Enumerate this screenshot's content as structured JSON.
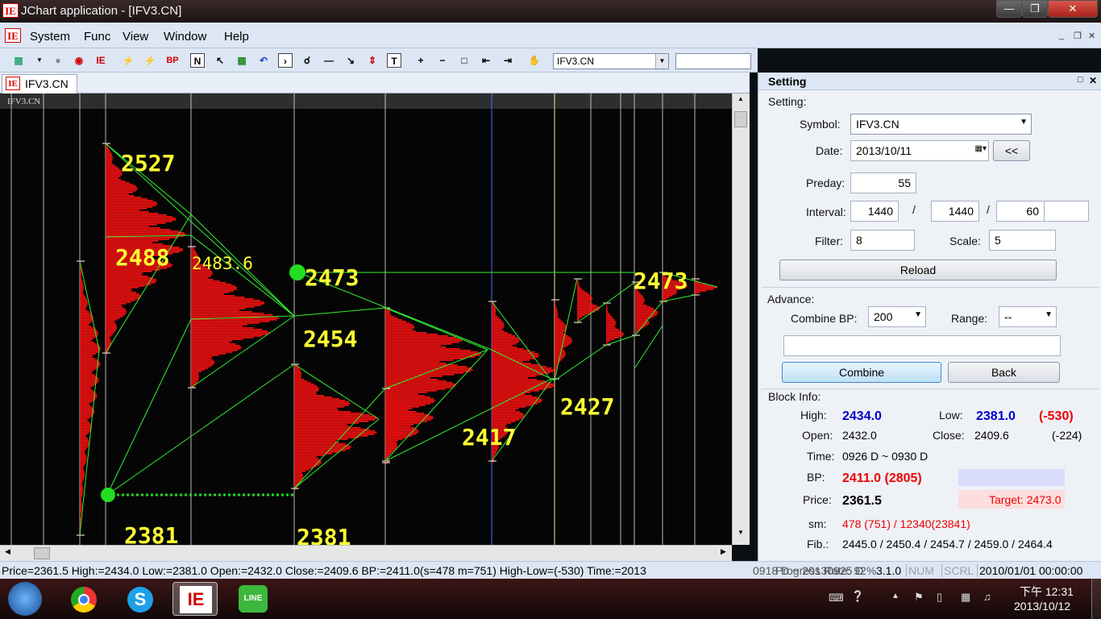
{
  "window": {
    "title": "JChart application - [IFV3.CN]"
  },
  "menu": {
    "items": [
      "System",
      "Func",
      "View",
      "Window",
      "Help"
    ]
  },
  "toolbar": {
    "symbol": "IFV3.CN",
    "bp_label": "BP",
    "n_label": "N",
    "t_label": "T"
  },
  "tab": {
    "label": "IFV3.CN"
  },
  "chart": {
    "header_label": "IFV3.CN",
    "price_labels": [
      {
        "text": "2527",
        "bold": true
      },
      {
        "text": "2488",
        "bold": true
      },
      {
        "text": "2483.6",
        "bold": false
      },
      {
        "text": "2473",
        "bold": true
      },
      {
        "text": "2454",
        "bold": true
      },
      {
        "text": "2473",
        "bold": true
      },
      {
        "text": "2427",
        "bold": true
      },
      {
        "text": "2417",
        "bold": true
      },
      {
        "text": "2381",
        "bold": true
      },
      {
        "text": "2381",
        "bold": true
      }
    ],
    "colors": {
      "profile": "#ff1010",
      "lines": "#33ee33",
      "labels": "#ffff33",
      "dots": "#22dd22",
      "grid": "#d8d8d8",
      "marker": "#4a6cff"
    }
  },
  "panel": {
    "title": "Setting",
    "setting_group": "Setting:",
    "symbol_label": "Symbol:",
    "symbol_value": "IFV3.CN",
    "date_label": "Date:",
    "date_value": "2013/10/11",
    "date_back": "<<",
    "preday_label": "Preday:",
    "preday_value": "55",
    "interval_label": "Interval:",
    "interval_1": "1440",
    "interval_2": "1440",
    "interval_3": "60",
    "interval_4": "",
    "slash": "/",
    "filter_label": "Filter:",
    "filter_value": "8",
    "scale_label": "Scale:",
    "scale_value": "5",
    "reload": "Reload",
    "advance_group": "Advance:",
    "combine_label": "Combine BP:",
    "combine_value": "200",
    "range_label": "Range:",
    "range_value": "--",
    "combine_btn": "Combine",
    "back_btn": "Back",
    "block_group": "Block Info:",
    "high_label": "High:",
    "high_value": "2434.0",
    "low_label": "Low:",
    "low_value": "2381.0",
    "low_diff": "(-530)",
    "open_label": "Open:",
    "open_value": "2432.0",
    "close_label": "Close:",
    "close_value": "2409.6",
    "close_diff": "(-224)",
    "time_label": "Time:",
    "time_value": "0926 D ~ 0930 D",
    "bp_label": "BP:",
    "bp_value": "2411.0 (2805)",
    "price_label": "Price:",
    "price_value": "2361.5",
    "target": "Target: 2473.0",
    "sm_label": "sm:",
    "sm_value": "478 (751) / 12340(23841)",
    "fib_label": "Fib.:",
    "fib_value": "2445.0 / 2450.4 / 2454.7 / 2459.0 / 2464.4"
  },
  "status": {
    "main": "Price=2361.5  High:=2434.0  Low:=2381.0  Open:=2432.0  Close:=2409.6  BP:=2411.0(s=478 m=751)  High-Low=(-530)  Time:=2013",
    "overlay": "0918 D ~ 20130925 D",
    "progress": "Progress Rate: 92%",
    "version": "3.1.0",
    "num": "NUM",
    "scrl": "SCRL",
    "datetime": "2010/01/01 00:00:00"
  },
  "taskbar": {
    "time": "下午 12:31",
    "date": "2013/10/12"
  }
}
